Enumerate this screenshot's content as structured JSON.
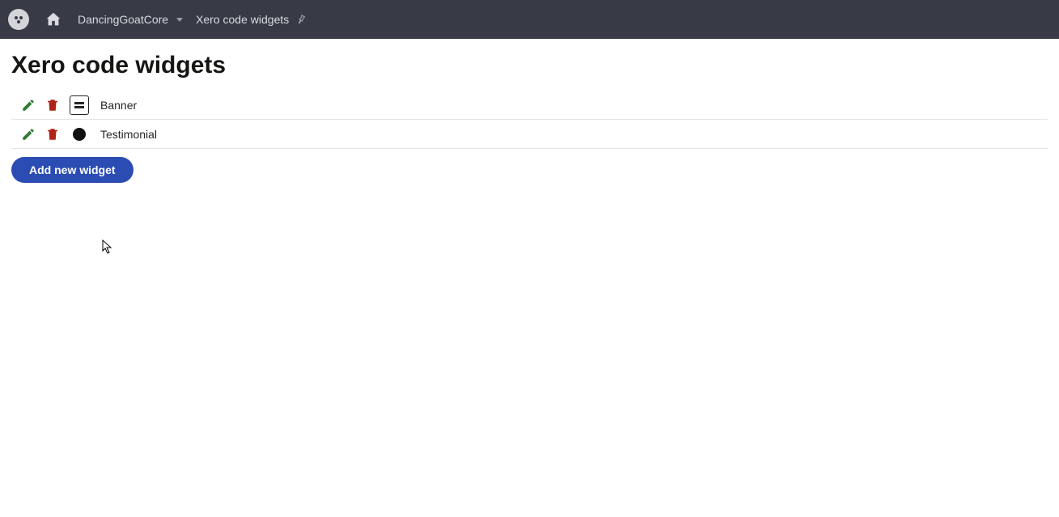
{
  "breadcrumb": {
    "site": "DancingGoatCore",
    "current": "Xero code widgets"
  },
  "page": {
    "title": "Xero code widgets"
  },
  "widgets": [
    {
      "name": "Banner",
      "icon": "banner"
    },
    {
      "name": "Testimonial",
      "icon": "circle"
    }
  ],
  "buttons": {
    "add": "Add new widget"
  }
}
